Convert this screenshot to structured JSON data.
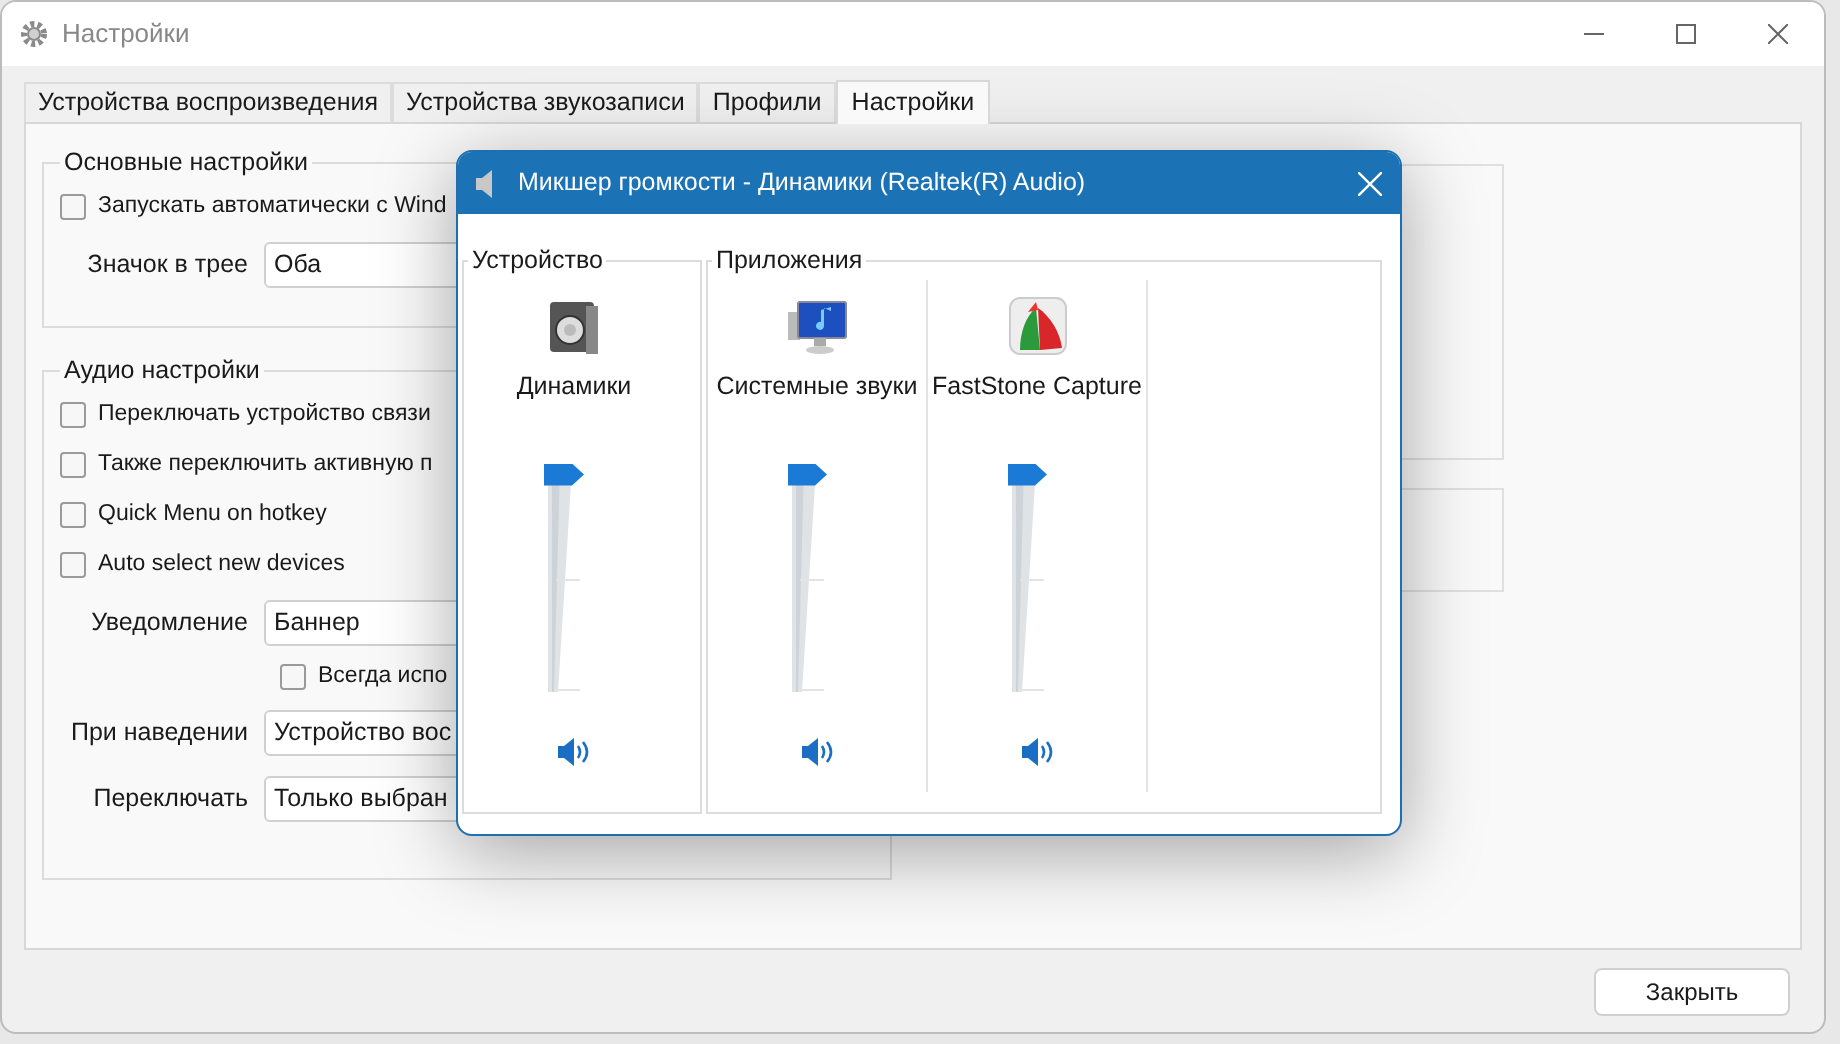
{
  "window": {
    "title": "Настройки"
  },
  "tabs": [
    {
      "label": "Устройства воспроизведения",
      "selected": false
    },
    {
      "label": "Устройства звукозаписи",
      "selected": false
    },
    {
      "label": "Профили",
      "selected": false
    },
    {
      "label": "Настройки",
      "selected": true
    }
  ],
  "basic_settings": {
    "title": "Основные настройки",
    "items": [
      {
        "kind": "checkbox",
        "label": "Запускать автоматически с Wind",
        "checked": false
      },
      {
        "kind": "combo",
        "label": "Значок в трее",
        "value": "Оба"
      }
    ]
  },
  "audio_settings": {
    "title": "Аудио настройки",
    "items": [
      {
        "kind": "checkbox",
        "label": "Переключать устройство связи",
        "checked": false
      },
      {
        "kind": "checkbox",
        "label": "Также переключить активную п",
        "checked": false
      },
      {
        "kind": "checkbox",
        "label": "Quick Menu on hotkey",
        "checked": false
      },
      {
        "kind": "checkbox",
        "label": "Auto select new devices",
        "checked": false
      },
      {
        "kind": "combo",
        "label": "Уведомление",
        "value": "Баннер"
      },
      {
        "kind": "subcheckbox",
        "label": "Всегда испо",
        "checked": false
      },
      {
        "kind": "combo",
        "label": "При наведении",
        "value": "Устройство вос"
      },
      {
        "kind": "combo",
        "label": "Переключать",
        "value": "Только выбран"
      }
    ]
  },
  "close_button": "Закрыть",
  "mixer": {
    "title": "Микшер громкости - Динамики (Realtek(R) Audio)",
    "device_group": "Устройство",
    "apps_group": "Приложения",
    "device": {
      "kind": "speaker",
      "name": "Динамики",
      "level": 1,
      "muted": false
    },
    "apps": [
      {
        "kind": "monitor",
        "name": "Системные звуки",
        "level": 1,
        "muted": false
      },
      {
        "kind": "capture",
        "name": "FastStone Capture",
        "level": 1,
        "muted": false
      }
    ]
  }
}
